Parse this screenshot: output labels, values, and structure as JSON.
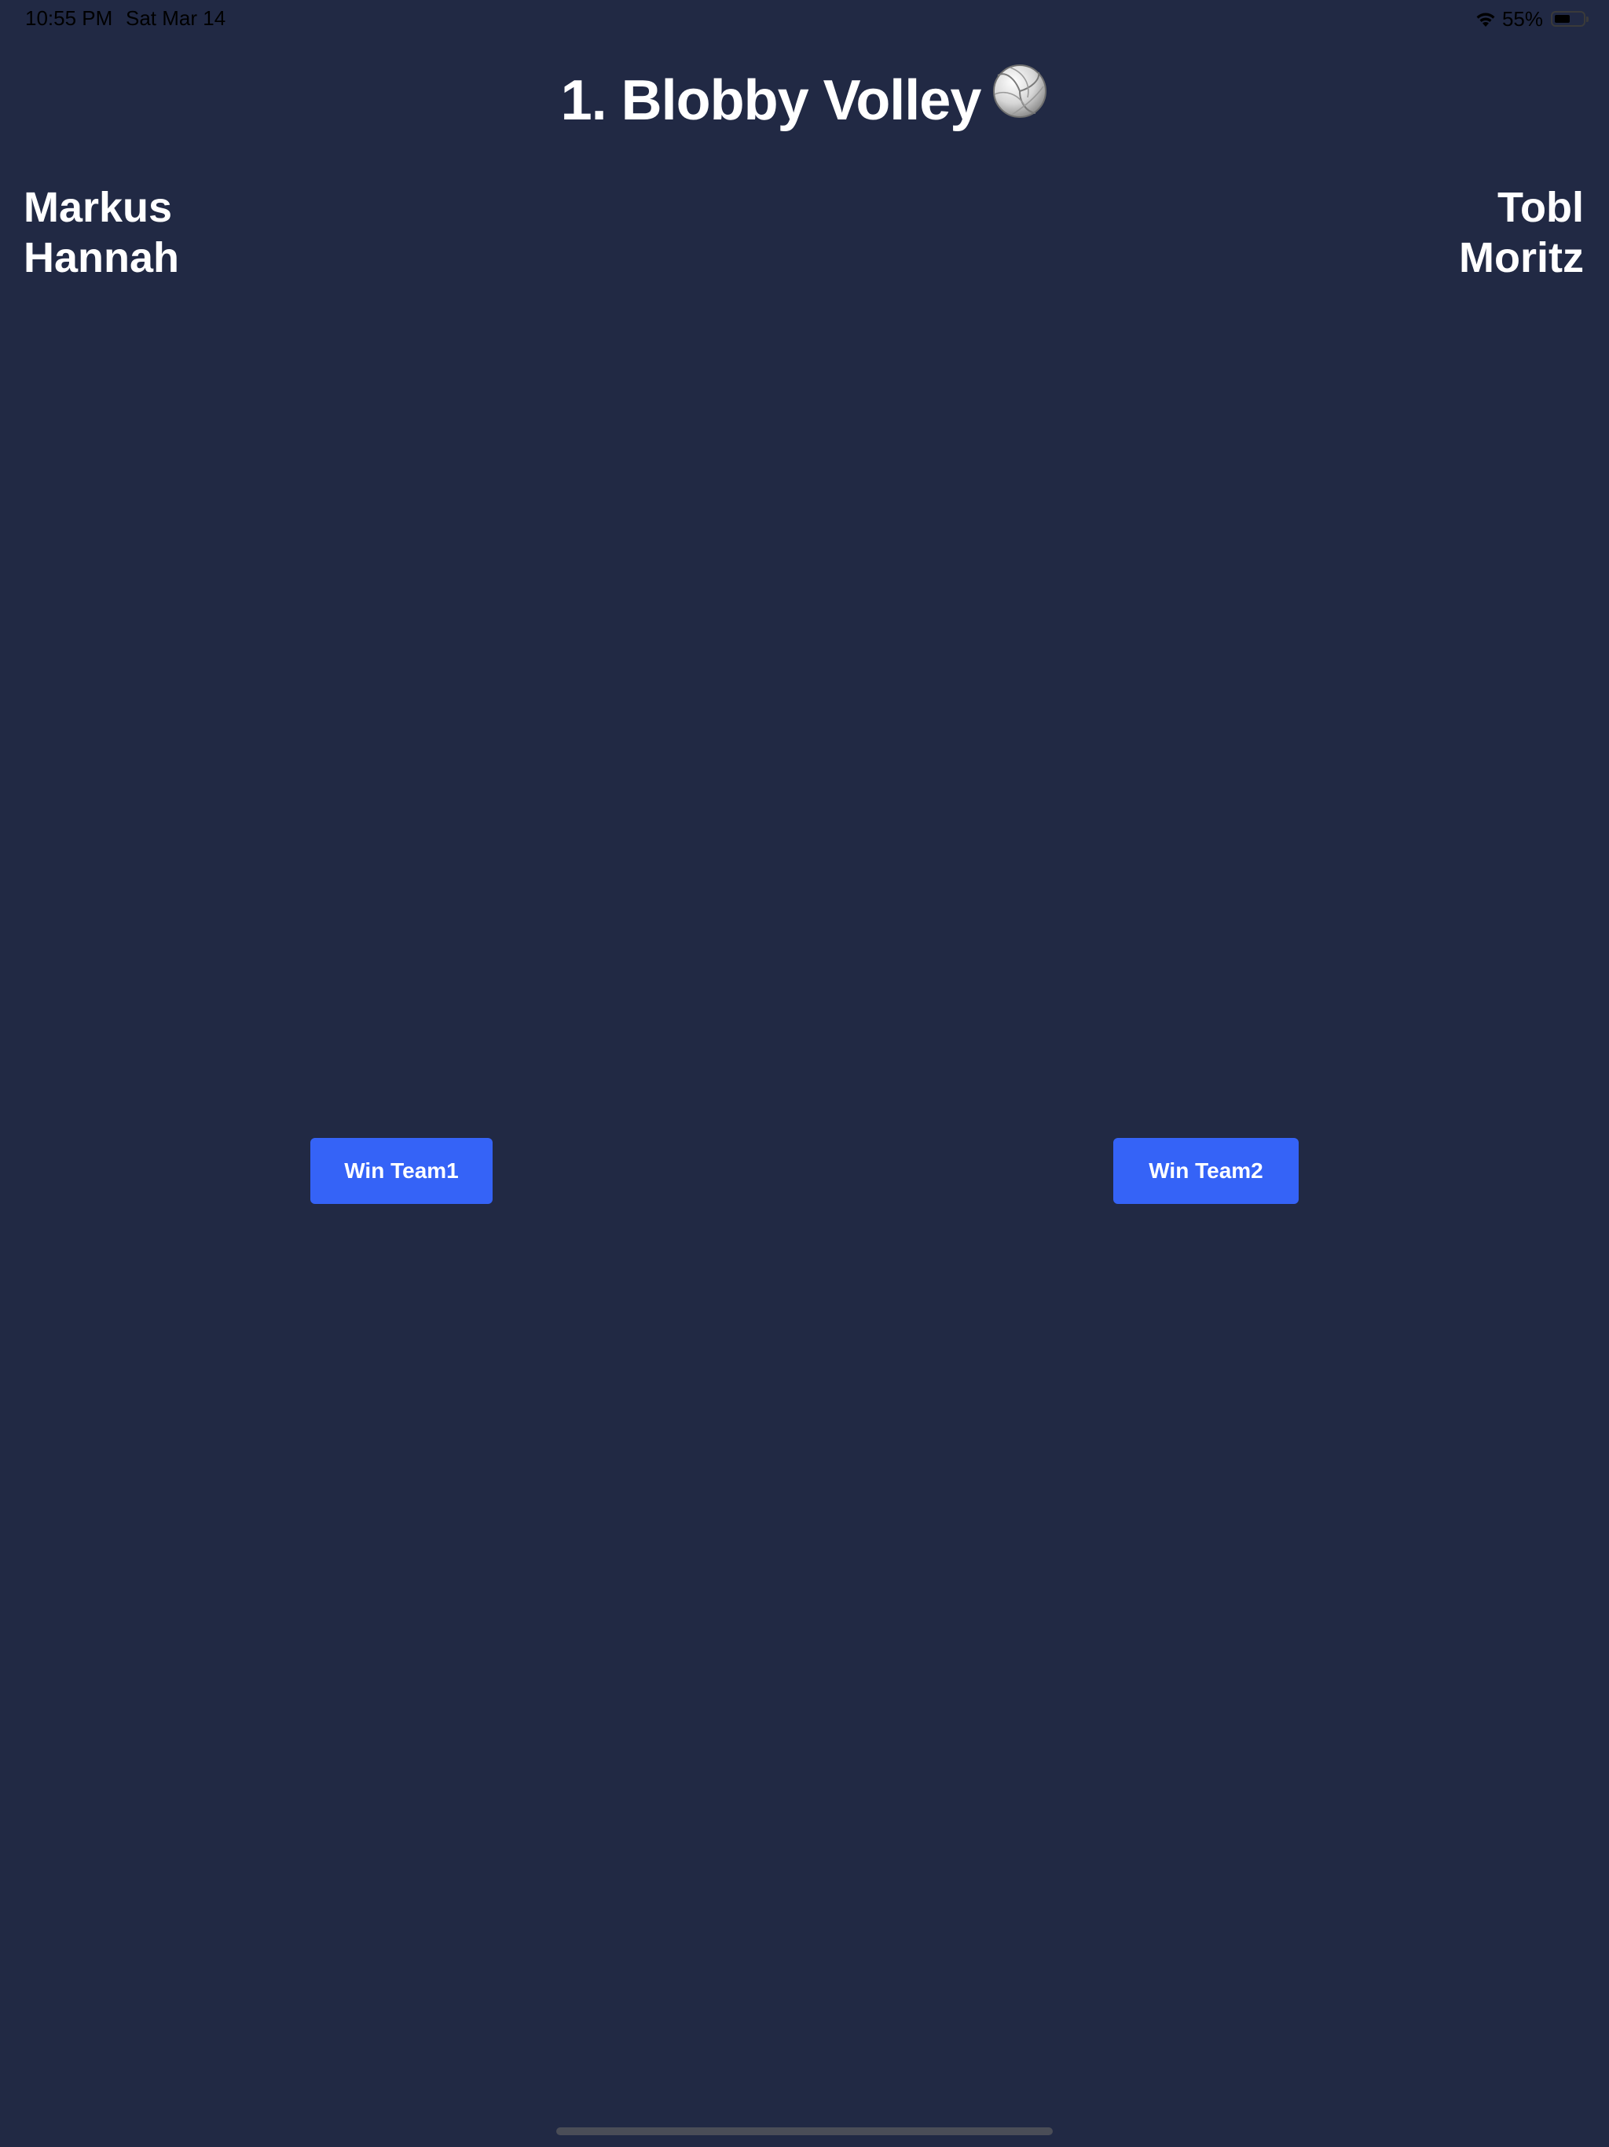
{
  "status_bar": {
    "time": "10:55 PM",
    "date": "Sat Mar 14",
    "battery_percent": "55%",
    "battery_level": 0.55,
    "icons": [
      "wifi-icon",
      "battery-icon"
    ]
  },
  "game": {
    "title": "1. Blobby Volley",
    "title_icon": "volleyball-icon"
  },
  "teams": {
    "team1": {
      "players": [
        "Markus",
        "Hannah"
      ],
      "win_button_label": "Win Team1"
    },
    "team2": {
      "players": [
        "Tobl",
        "Moritz"
      ],
      "win_button_label": "Win Team2"
    }
  },
  "colors": {
    "background": "#212944",
    "button": "#3563f7",
    "text": "#ffffff"
  }
}
